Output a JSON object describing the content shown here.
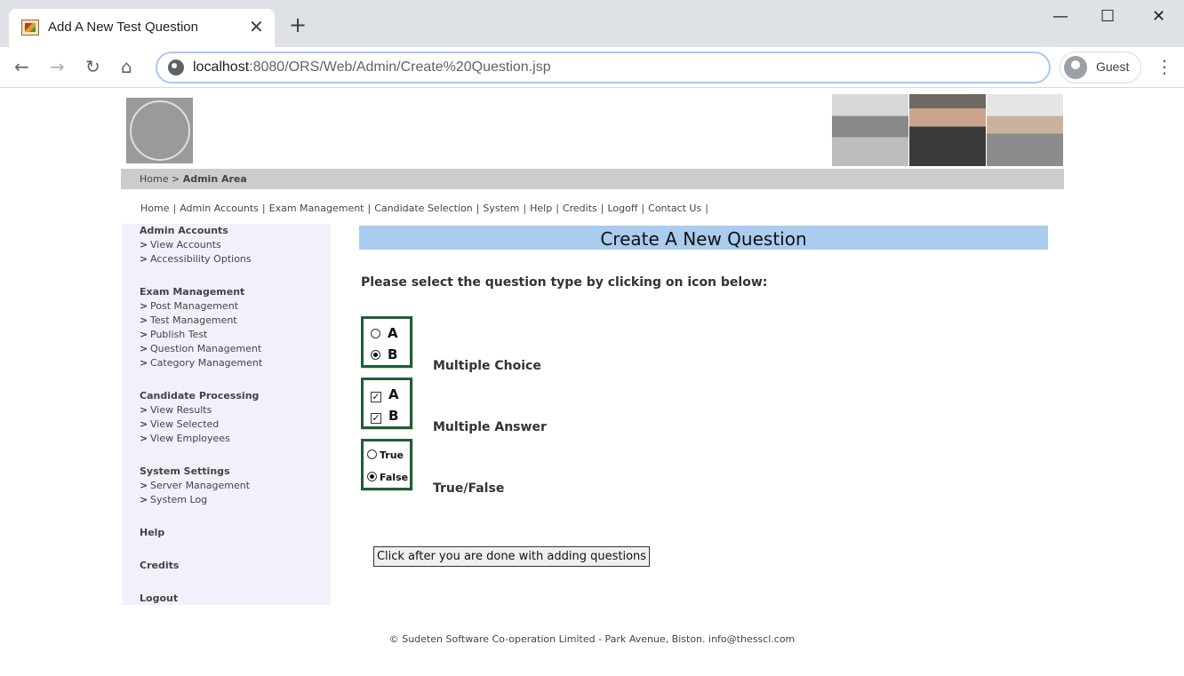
{
  "browser": {
    "tab_title": "Add A New Test Question",
    "tab_close": "✕",
    "new_tab": "+",
    "url_host": "localhost",
    "url_path": ":8080/ORS/Web/Admin/Create%20Question.jsp",
    "profile_label": "Guest",
    "back": "←",
    "forward": "→",
    "reload": "↻",
    "home": "⌂",
    "menu": "⋮",
    "minimize": "—",
    "maximize": "☐",
    "close": "✕"
  },
  "breadcrumb": {
    "home": "Home",
    "sep": ">",
    "current": "Admin Area"
  },
  "topnav": {
    "home": "Home",
    "admin_accounts": "Admin Accounts",
    "exam_management": "Exam Management",
    "candidate_selection": "Candidate Selection",
    "system": "System",
    "help": "Help",
    "credits": "Credits",
    "logoff": "Logoff",
    "contact_us": "Contact Us",
    "sep": "|"
  },
  "sidebar": {
    "admin_accounts": "Admin Accounts",
    "view_accounts": "View Accounts",
    "accessibility_options": "Accessibility Options",
    "exam_management": "Exam Management",
    "post_management": "Post Management",
    "test_management": "Test Management",
    "publish_test": "Publish Test",
    "question_management": "Question Management",
    "category_management": "Category Management",
    "candidate_processing": "Candidate Processing",
    "view_results": "View Results",
    "view_selected": "View Selected",
    "view_employees": "View Employees",
    "system_settings": "System Settings",
    "server_management": "Server Management",
    "system_log": "System Log",
    "help": "Help",
    "credits": "Credits",
    "logout": "Logout",
    "chevron": ">"
  },
  "main": {
    "heading": "Create A New Question",
    "instructions": "Please select the question type by clicking on icon below:",
    "types": {
      "multiple_choice": "Multiple Choice",
      "multiple_answer": "Multiple Answer",
      "true_false": "True/False"
    },
    "icon_text": {
      "a": "A",
      "b": "B",
      "true": "True",
      "false": "False",
      "check": "✓"
    },
    "done_button": "Click after you are done with adding questions"
  },
  "footer": "© Sudeten Software Co-operation Limited - Park Avenue, Biston. info@thesscl.com"
}
